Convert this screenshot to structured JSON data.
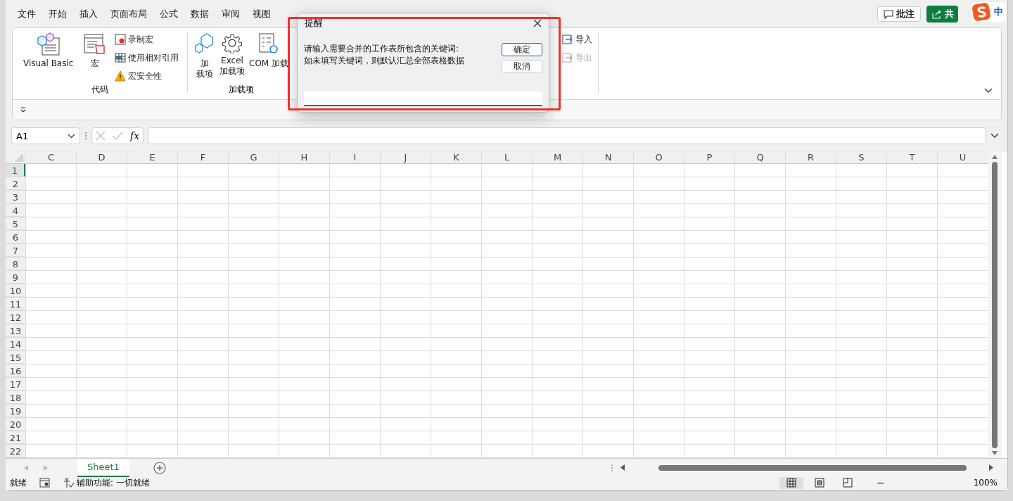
{
  "menu_tabs": [
    {
      "label": "文件",
      "selected": false
    },
    {
      "label": "开始",
      "selected": false
    },
    {
      "label": "插入",
      "selected": false
    },
    {
      "label": "页面布局",
      "selected": false
    },
    {
      "label": "公式",
      "selected": false
    },
    {
      "label": "数据",
      "selected": false
    },
    {
      "label": "审阅",
      "selected": false
    },
    {
      "label": "视图",
      "selected": false
    }
  ],
  "comment_button": "批注",
  "share_button": "共",
  "ime_indicator": "中",
  "ribbon": {
    "code_group": {
      "label": "代码",
      "visual_basic": "Visual Basic",
      "macros": "宏",
      "record_macro": "录制宏",
      "relative_refs": "使用相对引用",
      "macro_security": "宏安全性"
    },
    "addins_group": {
      "label": "加载项",
      "addins": [
        "加",
        "载项"
      ],
      "excel_addins": [
        "Excel",
        "加载项"
      ],
      "com_addins": "COM 加载"
    },
    "xml_group": [
      {
        "label": "导入",
        "disabled": false
      },
      {
        "label": "导出",
        "disabled": true
      }
    ]
  },
  "formula_bar": {
    "name_box": "A1",
    "function_label": "fx"
  },
  "sheet": {
    "columns": [
      "C",
      "D",
      "E",
      "F",
      "G",
      "H",
      "I",
      "J",
      "K",
      "L",
      "M",
      "N",
      "O",
      "P",
      "Q",
      "R",
      "S",
      "T",
      "U"
    ],
    "rows": [
      {
        "label": "1",
        "selected": true
      },
      {
        "label": "2",
        "selected": false
      },
      {
        "label": "3",
        "selected": false
      },
      {
        "label": "4",
        "selected": false
      },
      {
        "label": "5",
        "selected": false
      },
      {
        "label": "6",
        "selected": false
      },
      {
        "label": "7",
        "selected": false
      },
      {
        "label": "8",
        "selected": false
      },
      {
        "label": "9",
        "selected": false
      },
      {
        "label": "10",
        "selected": false
      },
      {
        "label": "11",
        "selected": false
      },
      {
        "label": "12",
        "selected": false
      },
      {
        "label": "13",
        "selected": false
      },
      {
        "label": "14",
        "selected": false
      },
      {
        "label": "15",
        "selected": false
      },
      {
        "label": "16",
        "selected": false
      },
      {
        "label": "17",
        "selected": false
      },
      {
        "label": "18",
        "selected": false
      },
      {
        "label": "19",
        "selected": false
      },
      {
        "label": "20",
        "selected": false
      },
      {
        "label": "21",
        "selected": false
      },
      {
        "label": "22",
        "selected": false
      }
    ]
  },
  "sheet_tabs": [
    {
      "label": "Sheet1",
      "selected": true
    }
  ],
  "status_bar": {
    "ready": "就绪",
    "accessibility": "辅助功能: 一切就绪",
    "views": [
      {
        "kind": "normal",
        "selected": true
      },
      {
        "kind": "page_layout",
        "selected": false
      },
      {
        "kind": "page_break",
        "selected": false
      }
    ],
    "zoom_out": "−",
    "zoom": "100%"
  },
  "dialog": {
    "title": "提醒",
    "message": [
      "请输入需要合并的工作表所包含的关键词:",
      "如未填写关键词，则默认汇总全部表格数据"
    ],
    "buttons": [
      {
        "label": "确定",
        "default": true
      },
      {
        "label": "取消",
        "default": false
      }
    ]
  }
}
